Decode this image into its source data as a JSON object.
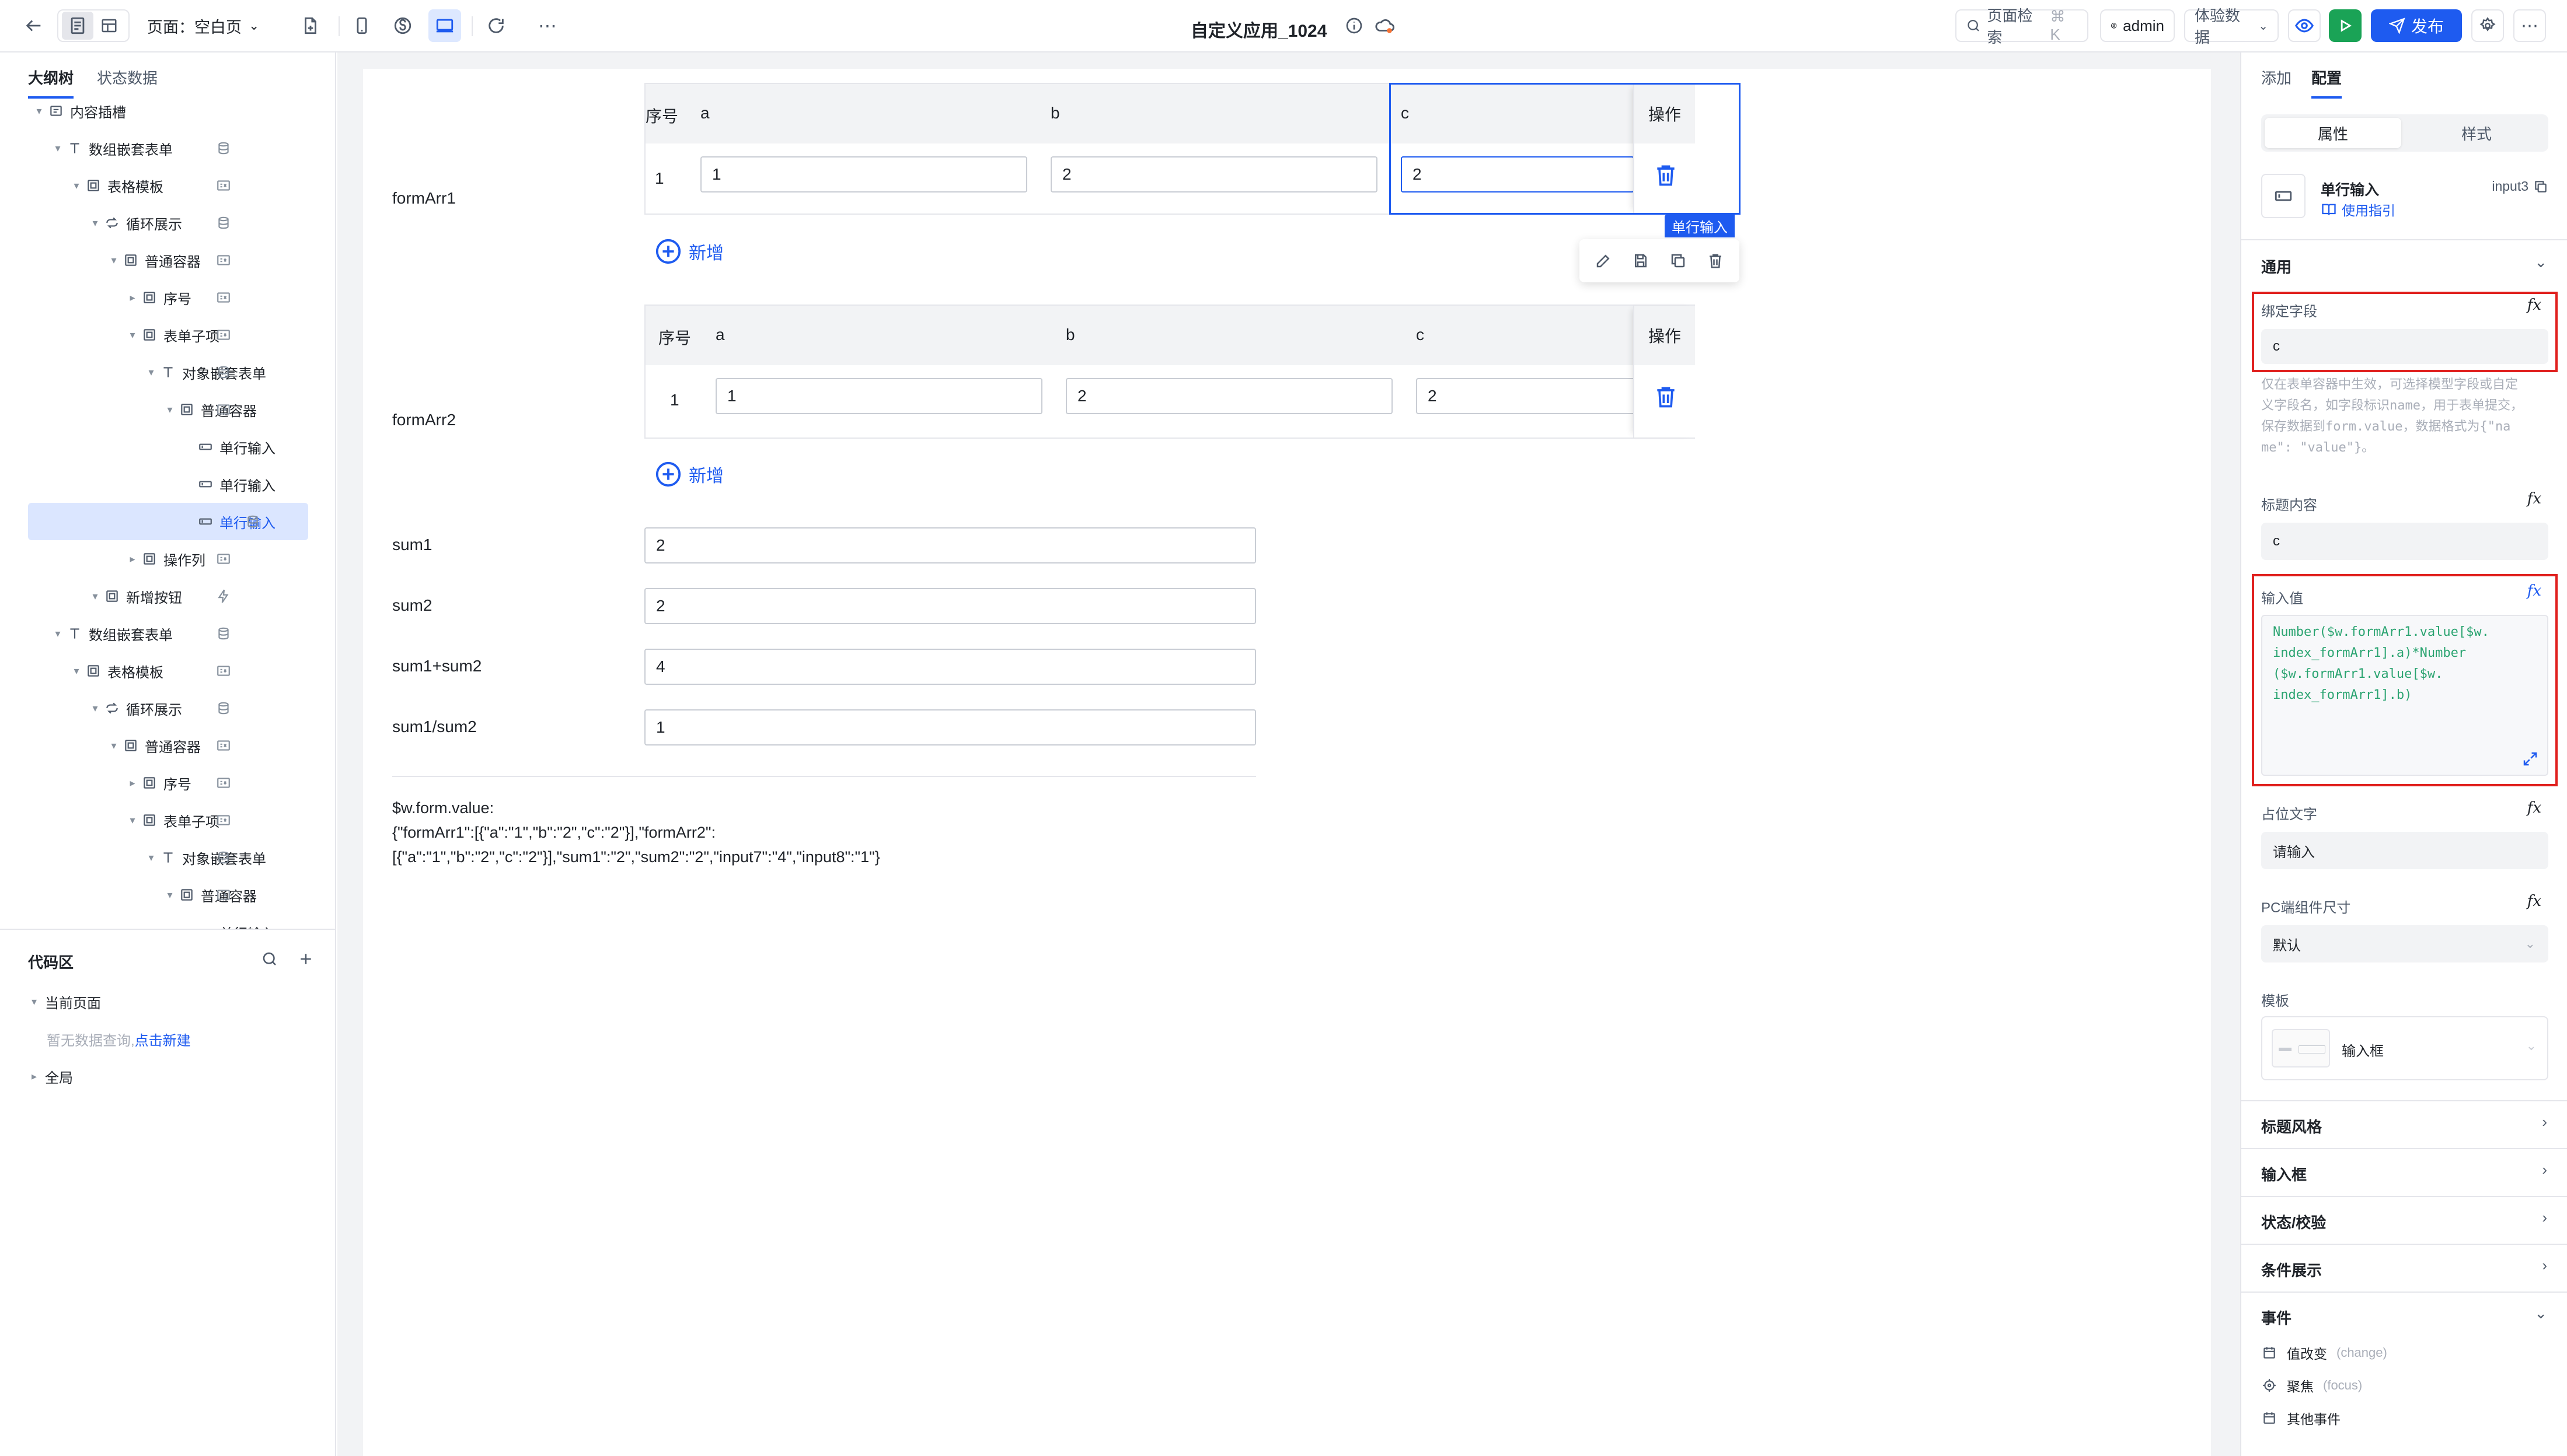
{
  "topbar": {
    "page_label": "页面：空白页",
    "app_title": "自定义应用_1024",
    "search_label": "页面检索",
    "search_shortcut": "⌘ K",
    "user": "admin",
    "experience_data": "体验数据",
    "publish": "发布"
  },
  "left": {
    "tabs": [
      "大纲树",
      "状态数据"
    ],
    "tree": [
      {
        "label": "内容插槽",
        "depth": 1,
        "icon": "slot",
        "right": ""
      },
      {
        "label": "数组嵌套表单",
        "depth": 2,
        "icon": "text",
        "right": "db"
      },
      {
        "label": "表格模板",
        "depth": 3,
        "icon": "box",
        "right": "els"
      },
      {
        "label": "循环展示",
        "depth": 4,
        "icon": "loop",
        "right": "db"
      },
      {
        "label": "普通容器",
        "depth": 5,
        "icon": "box",
        "right": "els"
      },
      {
        "label": "序号",
        "depth": 6,
        "icon": "box",
        "right": "els"
      },
      {
        "label": "表单子项",
        "depth": 6,
        "icon": "box",
        "right": "els"
      },
      {
        "label": "对象嵌套表单",
        "depth": 7,
        "icon": "text",
        "right": "db"
      },
      {
        "label": "普通容器",
        "depth": 8,
        "icon": "box",
        "right": "els"
      },
      {
        "label": "单行输入",
        "depth": 9,
        "icon": "input",
        "right": ""
      },
      {
        "label": "单行输入",
        "depth": 9,
        "icon": "input",
        "right": ""
      },
      {
        "label": "单行输入",
        "depth": 9,
        "icon": "input",
        "right": "db",
        "selected": true
      },
      {
        "label": "操作列",
        "depth": 6,
        "icon": "box",
        "right": "els"
      },
      {
        "label": "新增按钮",
        "depth": 4,
        "icon": "box",
        "right": "bolt"
      },
      {
        "label": "数组嵌套表单",
        "depth": 2,
        "icon": "text",
        "right": "db"
      },
      {
        "label": "表格模板",
        "depth": 3,
        "icon": "box",
        "right": "els"
      },
      {
        "label": "循环展示",
        "depth": 4,
        "icon": "loop",
        "right": "db"
      },
      {
        "label": "普通容器",
        "depth": 5,
        "icon": "box",
        "right": "els"
      },
      {
        "label": "序号",
        "depth": 6,
        "icon": "box",
        "right": "els"
      },
      {
        "label": "表单子项",
        "depth": 6,
        "icon": "box",
        "right": "els"
      },
      {
        "label": "对象嵌套表单",
        "depth": 7,
        "icon": "text",
        "right": "db"
      },
      {
        "label": "普通容器",
        "depth": 8,
        "icon": "box",
        "right": "els"
      },
      {
        "label": "单行输入",
        "depth": 9,
        "icon": "input",
        "right": ""
      }
    ],
    "code": {
      "title": "代码区",
      "current_page": "当前页面",
      "no_query": "暂无数据查询,",
      "create_link": "点击新建",
      "global": "全局"
    }
  },
  "canvas": {
    "form1_label": "formArr1",
    "form2_label": "formArr2",
    "table_headers": {
      "index": "序号",
      "a": "a",
      "b": "b",
      "c": "c",
      "op": "操作"
    },
    "form1_row": {
      "index": "1",
      "a": "1",
      "b": "2",
      "c": "2"
    },
    "form2_row": {
      "index": "1",
      "a": "1",
      "b": "2",
      "c": "2"
    },
    "add_label": "新增",
    "selected_tag": "单行输入",
    "sums": [
      {
        "label": "sum1",
        "value": "2"
      },
      {
        "label": "sum2",
        "value": "2"
      },
      {
        "label": "sum1+sum2",
        "value": "4"
      },
      {
        "label": "sum1/sum2",
        "value": "1"
      }
    ],
    "json_title": "$w.form.value:",
    "json_line1": "{\"formArr1\":[{\"a\":\"1\",\"b\":\"2\",\"c\":\"2\"}],\"formArr2\":",
    "json_line2": "[{\"a\":\"1\",\"b\":\"2\",\"c\":\"2\"}],\"sum1\":\"2\",\"sum2\":\"2\",\"input7\":\"4\",\"input8\":\"1\"}"
  },
  "right": {
    "tabs": [
      "添加",
      "配置"
    ],
    "seg": [
      "属性",
      "样式"
    ],
    "component_name": "单行输入",
    "component_id": "input3",
    "usage_guide": "使用指引",
    "section_general": "通用",
    "bind_field_label": "绑定字段",
    "bind_field_value": "c",
    "bind_help_1": "仅在表单容器中生效，可选择模型字段或自定",
    "bind_help_2": "义字段名，如字段标识name，用于表单提交，",
    "bind_help_3": "保存数据到form.value，数据格式为{\"na",
    "bind_help_4": "me\": \"value\"}。",
    "title_label": "标题内容",
    "title_value": "c",
    "input_value_label": "输入值",
    "expr_1": "Number($w.formArr1.value[$w.",
    "expr_2": "index_formArr1].a)*Number",
    "expr_3": "($w.formArr1.value[$w.",
    "expr_4": "index_formArr1].b)",
    "placeholder_label": "占位文字",
    "placeholder_value": "请输入",
    "pc_size_label": "PC端组件尺寸",
    "pc_size_value": "默认",
    "template_label": "模板",
    "template_value": "输入框",
    "sections": [
      "标题风格",
      "输入框",
      "状态/校验",
      "条件展示"
    ],
    "events_title": "事件",
    "events": [
      {
        "name": "值改变",
        "code": "(change)"
      },
      {
        "name": "聚焦",
        "code": "(focus)"
      },
      {
        "name": "其他事件",
        "code": ""
      }
    ]
  },
  "colors": {
    "accent": "#1e5bf0",
    "highlight_red": "#e0201e",
    "code_green": "#2ba471",
    "run_green": "#1aa356"
  }
}
